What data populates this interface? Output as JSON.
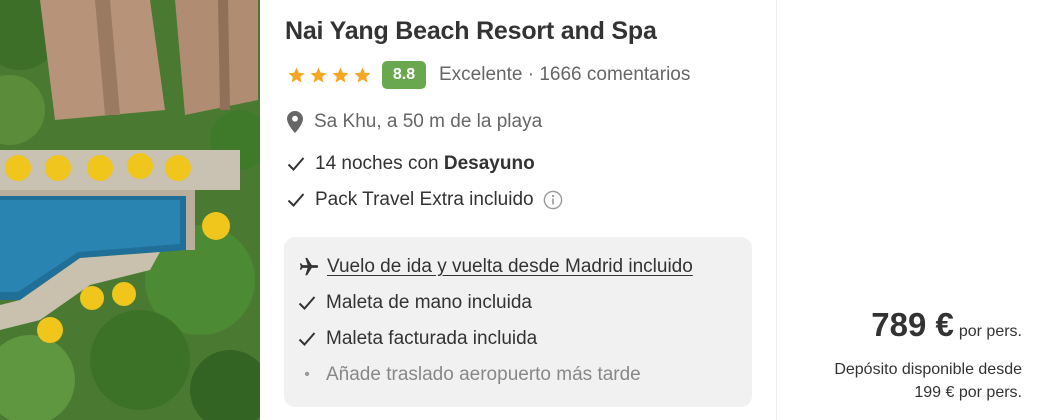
{
  "hotel": {
    "name": "Nai Yang Beach Resort and Spa",
    "stars": 4,
    "score": "8.8",
    "rating_text": "Excelente · 1666 comentarios",
    "location": "Sa Khu, a 50 m de la playa",
    "star_color": "#f5a623",
    "score_color": "#6aa84f"
  },
  "features": {
    "nights_prefix": "14 noches con ",
    "board": "Desayuno",
    "pack": "Pack Travel Extra incluido"
  },
  "flight": {
    "title": "Vuelo de ida y vuelta desde Madrid incluido",
    "hand_bag": "Maleta de mano incluida",
    "checked_bag": "Maleta facturada incluida",
    "transfer": "Añade traslado aeropuerto más tarde"
  },
  "price": {
    "amount": "789 €",
    "per": "por pers.",
    "deposit_line1": "Depósito disponible desde",
    "deposit_line2": "199 € por pers."
  },
  "icons": {
    "star": "star-icon",
    "location": "location-pin-icon",
    "check": "check-icon",
    "info": "info-icon",
    "plane": "plane-icon"
  }
}
